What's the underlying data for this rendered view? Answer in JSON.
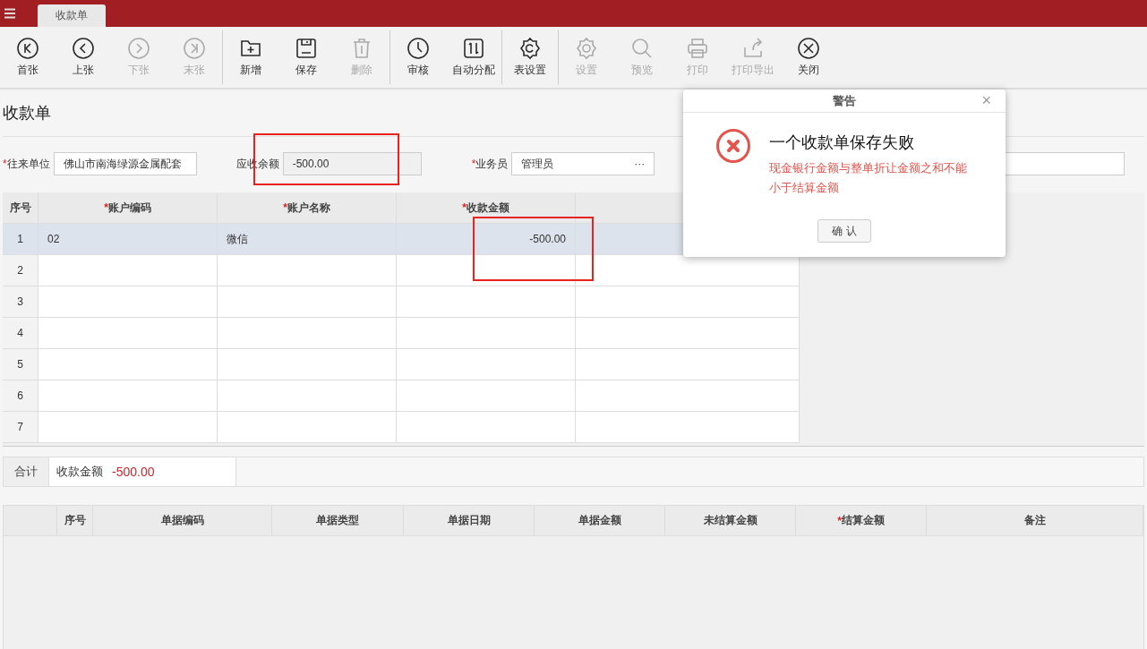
{
  "header": {
    "tabs": [
      {
        "label": "收款单",
        "selected": true
      }
    ]
  },
  "toolbar": {
    "groups": [
      [
        {
          "label": "首张",
          "disabled": false
        },
        {
          "label": "上张",
          "disabled": false
        },
        {
          "label": "下张",
          "disabled": true
        },
        {
          "label": "末张",
          "disabled": true
        }
      ],
      [
        {
          "label": "新增",
          "disabled": false
        },
        {
          "label": "保存",
          "disabled": false
        },
        {
          "label": "删除",
          "disabled": true
        }
      ],
      [
        {
          "label": "审核",
          "disabled": false
        },
        {
          "label": "自动分配",
          "disabled": false
        }
      ],
      [
        {
          "label": "表设置",
          "disabled": false
        }
      ],
      [
        {
          "label": "设置",
          "disabled": true
        },
        {
          "label": "预览",
          "disabled": true
        },
        {
          "label": "打印",
          "disabled": true
        },
        {
          "label": "打印导出",
          "disabled": true
        },
        {
          "label": "关闭",
          "disabled": false
        }
      ]
    ]
  },
  "page_title": "收款单",
  "form": {
    "fields": [
      {
        "required_mark": "*",
        "label": "往来单位",
        "value": "佛山市南海绿源金属配套",
        "readonly": false
      },
      {
        "label": "应收余额",
        "value": "-500.00",
        "readonly": true
      },
      {
        "required_mark": "*",
        "label": "业务员",
        "value": "管理员",
        "readonly": false,
        "picker_label": "···"
      },
      {
        "readonly": false
      }
    ]
  },
  "accounts_table": {
    "columns": [
      {
        "label": "序号"
      },
      {
        "required_mark": "*",
        "label": "账户编码"
      },
      {
        "required_mark": "*",
        "label": "账户名称"
      },
      {
        "required_mark": "*",
        "label": "收款金额"
      }
    ],
    "rows": [
      {
        "selected": true,
        "cells": [
          "1",
          "02",
          "微信",
          "-500.00"
        ]
      },
      {
        "selected": false,
        "cells": [
          "2"
        ]
      },
      {
        "selected": false,
        "cells": [
          "3"
        ]
      },
      {
        "selected": false,
        "cells": [
          "4"
        ]
      },
      {
        "selected": false,
        "cells": [
          "5"
        ]
      },
      {
        "selected": false,
        "cells": [
          "6"
        ]
      },
      {
        "selected": false,
        "cells": [
          "7"
        ]
      }
    ]
  },
  "totals": {
    "label": "合计",
    "field": "收款金额",
    "value": "-500.00"
  },
  "documents_table": {
    "columns": [
      {
        "label": "序号"
      },
      {
        "label": "单据编码"
      },
      {
        "label": "单据类型"
      },
      {
        "label": "单据日期"
      },
      {
        "label": "单据金额"
      },
      {
        "label": "未结算金额"
      },
      {
        "required_mark": "*",
        "label": "结算金额"
      },
      {
        "label": "备注"
      }
    ]
  },
  "dialog": {
    "title": "警告",
    "close": "×",
    "heading": "一个收款单保存失败",
    "message": "现金银行金额与整单折让金额之和不能小于结算金额",
    "button": "确 认"
  }
}
